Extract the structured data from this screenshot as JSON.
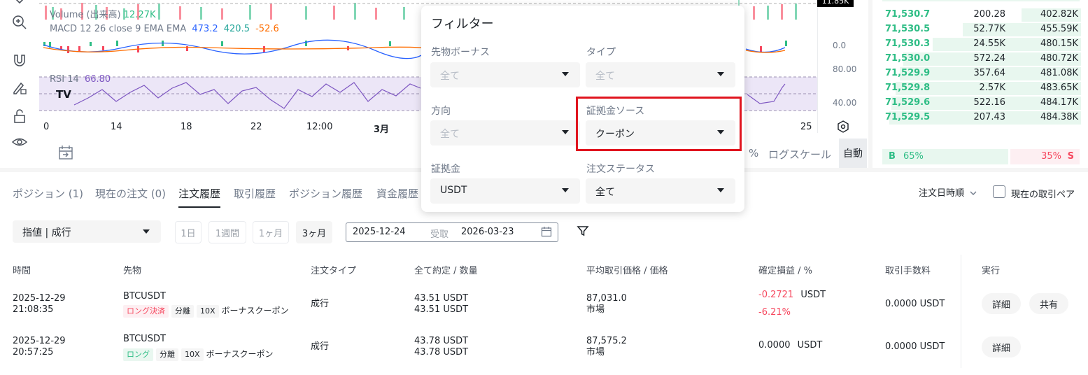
{
  "chart": {
    "volume_label": "Volume (出来高)",
    "volume_value": "12.27K",
    "volume_marker": "11.85K",
    "macd_label": "MACD 12 26 close 9 EMA EMA",
    "macd_v1": "473.2",
    "macd_v2": "420.5",
    "macd_v3": "-52.6",
    "rsi_label": "RSI 14",
    "rsi_value": "66.80",
    "y_macd_zero": "0.0",
    "y_rsi_80": "80.00",
    "y_rsi_40": "40.00",
    "x_ticks": [
      "0",
      "14",
      "18",
      "22",
      "12:00",
      "3月",
      "25"
    ],
    "percent_label": "%",
    "log_scale_label": "ログスケール",
    "auto_label": "自動"
  },
  "orderbook": {
    "rows": [
      {
        "price": "71,530.7",
        "amount": "200.28",
        "total": "402.82K",
        "fill": 0.3
      },
      {
        "price": "71,530.5",
        "amount": "52.77K",
        "total": "455.59K",
        "fill": 0.6
      },
      {
        "price": "71,530.3",
        "amount": "24.55K",
        "total": "480.15K",
        "fill": 0.75
      },
      {
        "price": "71,530.0",
        "amount": "572.24",
        "total": "480.72K",
        "fill": 0.9
      },
      {
        "price": "71,529.9",
        "amount": "357.64",
        "total": "481.08K",
        "fill": 0.92
      },
      {
        "price": "71,529.8",
        "amount": "2.57K",
        "total": "483.65K",
        "fill": 0.94
      },
      {
        "price": "71,529.6",
        "amount": "522.16",
        "total": "484.17K",
        "fill": 0.96
      },
      {
        "price": "71,529.5",
        "amount": "207.43",
        "total": "484.38K",
        "fill": 0.97
      }
    ],
    "buy_label": "B",
    "buy_pct": "65%",
    "sell_pct": "35%",
    "sell_label": "S",
    "buy_ratio": 0.65
  },
  "tabs": {
    "positions": "ポジション (1)",
    "open_orders": "現在の注文 (0)",
    "order_history": "注文履歴",
    "trade_history": "取引履歴",
    "position_history": "ポジション履歴",
    "funds_history": "資金履歴",
    "sort_label": "注文日時順",
    "current_pair_label": "現在の取引ペア"
  },
  "filterbar": {
    "order_type": "指値 | 成行",
    "range_1d": "1日",
    "range_1w": "1週間",
    "range_1m": "1ヶ月",
    "range_3m": "3ヶ月",
    "date_from": "2025-12-24",
    "date_sep": "受取",
    "date_to": "2026-03-23"
  },
  "table": {
    "headers": {
      "time": "時間",
      "futures": "先物",
      "order_type": "注文タイプ",
      "filled_qty": "全て約定 / 数量",
      "avg_price": "平均取引価格 / 価格",
      "pnl": "確定損益 / %",
      "fee": "取引手数料",
      "action": "実行"
    },
    "rows": [
      {
        "date": "2025-12-29",
        "time": "21:08:35",
        "symbol": "BTCUSDT",
        "side_tag": "ロング決済",
        "margin_tag": "分離",
        "lev_tag": "10X",
        "bonus": "ボーナスクーポン",
        "type": "成行",
        "filled": "43.51  USDT",
        "qty": "43.51  USDT",
        "avg": "87,031.0",
        "price": "市場",
        "pnl": "-0.2721",
        "pnl_unit": "USDT",
        "pnl_pct": "-6.21%",
        "fee": "0.0000 USDT",
        "btn_detail": "詳細",
        "btn_share": "共有"
      },
      {
        "date": "2025-12-29",
        "time": "20:57:25",
        "symbol": "BTCUSDT",
        "side_tag": "ロング",
        "margin_tag": "分離",
        "lev_tag": "10X",
        "bonus": "ボーナスクーポン",
        "type": "成行",
        "filled": "43.78  USDT",
        "qty": "43.78  USDT",
        "avg": "87,575.2",
        "price": "市場",
        "pnl": "0.0000",
        "pnl_unit": "USDT",
        "fee": "0.0000 USDT",
        "btn_detail": "詳細"
      }
    ]
  },
  "filter_popup": {
    "title": "フィルター",
    "futures_bonus_label": "先物ボーナス",
    "futures_bonus_value": "全て",
    "type_label": "タイプ",
    "type_value": "全て",
    "direction_label": "方向",
    "direction_value": "全て",
    "margin_source_label": "証拠金ソース",
    "margin_source_value": "クーポン",
    "margin_label": "証拠金",
    "margin_value": "USDT",
    "order_status_label": "注文ステータス",
    "order_status_value": "全て"
  },
  "icons": [
    "chevron-down-icon",
    "zoom-in-icon",
    "magnet-icon",
    "pencil-lock-icon",
    "unlock-icon",
    "eye-icon",
    "tradingview-logo",
    "goto-date-icon",
    "settings-icon",
    "filter-icon",
    "calendar-icon",
    "chevron-down-icon"
  ]
}
